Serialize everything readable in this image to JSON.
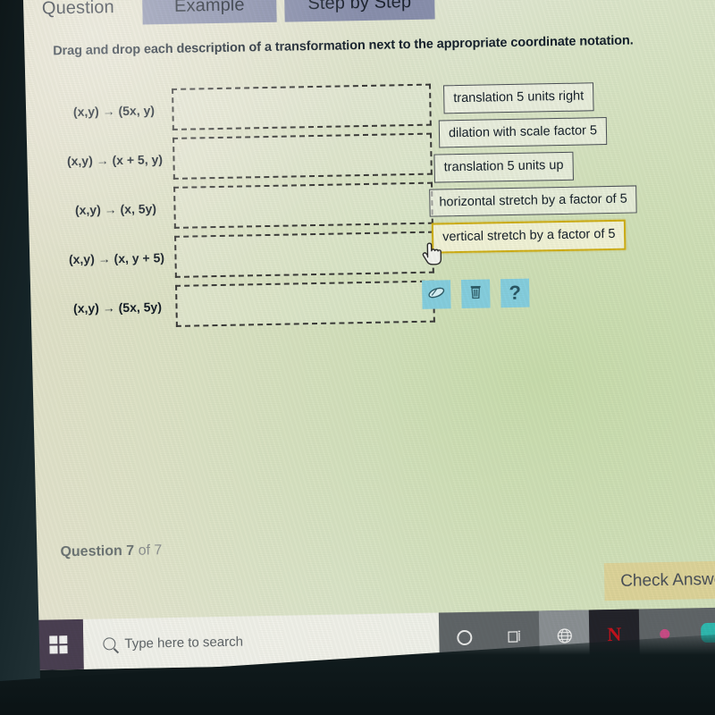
{
  "tabs": [
    {
      "label": "Question",
      "state": "active",
      "name": "tab-question"
    },
    {
      "label": "Example",
      "state": "inactive",
      "name": "tab-example"
    },
    {
      "label": "Step by Step",
      "state": "inactive",
      "name": "tab-step-by-step"
    }
  ],
  "prompt": "Drag and drop each description of a transformation next to the appropriate coordinate notation.",
  "notations": [
    "(x,y) → (5x, y)",
    "(x,y) → (x + 5, y)",
    "(x,y) → (x, 5y)",
    "(x,y) → (x, y + 5)",
    "(x,y) → (5x, 5y)"
  ],
  "dropzones": [
    {
      "value": ""
    },
    {
      "value": ""
    },
    {
      "value": ""
    },
    {
      "value": ""
    },
    {
      "value": ""
    }
  ],
  "chips": [
    {
      "label": "translation 5 units right",
      "selected": false
    },
    {
      "label": "dilation with scale factor 5",
      "selected": false
    },
    {
      "label": "translation 5 units up",
      "selected": false
    },
    {
      "label": "horizontal stretch by a factor of 5",
      "selected": false
    },
    {
      "label": "vertical stretch by a factor of 5",
      "selected": true
    }
  ],
  "tools": [
    {
      "icon": "eraser-icon",
      "label": ""
    },
    {
      "icon": "trash-icon",
      "label": ""
    },
    {
      "icon": "help-icon",
      "label": "?"
    }
  ],
  "footer": {
    "question_label": "Question 7",
    "question_total": "of 7",
    "check_answer_label": "Check Answer"
  },
  "taskbar": {
    "start_name": "windows-start-button",
    "search_placeholder": "Type here to search",
    "icons": [
      {
        "name": "cortana-icon",
        "label": ""
      },
      {
        "name": "task-view-icon",
        "label": ""
      },
      {
        "name": "browser-globe-icon",
        "label": ""
      },
      {
        "name": "netflix-icon",
        "label": "N"
      },
      {
        "name": "pink-app-icon",
        "label": ""
      },
      {
        "name": "teal-app-icon",
        "label": ""
      }
    ]
  },
  "colors": {
    "tab_inactive": "#8a90ae",
    "chip_selected_border": "#cfae14",
    "tool_button": "#86cfe0",
    "check_answer": "#ded49a",
    "netflix_red": "#c3121c"
  }
}
